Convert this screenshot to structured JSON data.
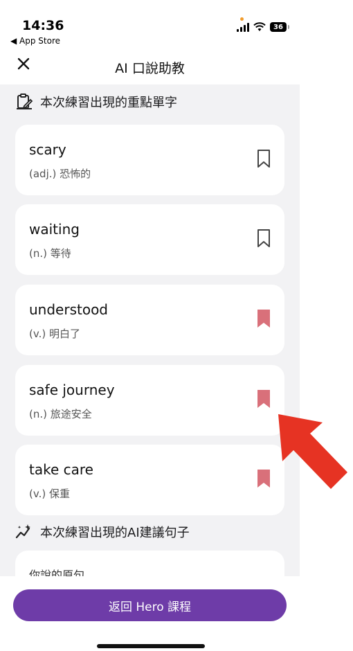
{
  "status_bar": {
    "time": "14:36",
    "back_app": "◀ App Store",
    "battery": "36"
  },
  "nav": {
    "close_icon": "close-icon",
    "title": "AI 口說助教"
  },
  "vocab_section": {
    "icon": "clipboard-edit-icon",
    "title": "本次練習出現的重點單字",
    "items": [
      {
        "word": "scary",
        "definition": "(adj.) 恐怖的",
        "bookmarked": false
      },
      {
        "word": "waiting",
        "definition": "(n.) 等待",
        "bookmarked": false
      },
      {
        "word": "understood",
        "definition": "(v.) 明白了",
        "bookmarked": true
      },
      {
        "word": "safe journey",
        "definition": "(n.) 旅途安全",
        "bookmarked": true
      },
      {
        "word": "take care",
        "definition": "(v.) 保重",
        "bookmarked": true
      }
    ]
  },
  "sentence_section": {
    "icon": "sparkle-chart-icon",
    "title": "本次練習出現的AI建議句子",
    "card_label": "你說的原句"
  },
  "footer": {
    "button_label": "返回 Hero 課程"
  },
  "colors": {
    "accent": "#6e3ca8",
    "bookmark_active": "#d9707a",
    "annotation": "#e63323",
    "content_bg": "#f2f2f4"
  }
}
